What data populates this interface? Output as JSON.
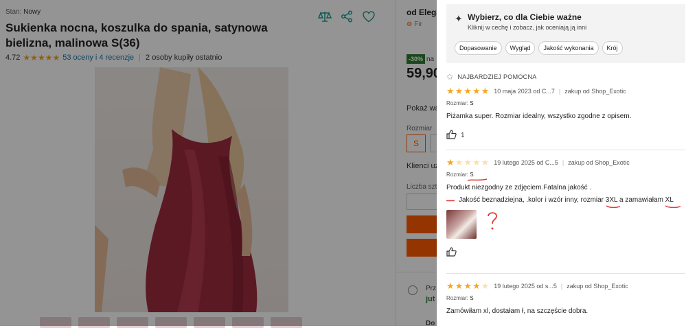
{
  "product": {
    "stan_label": "Stan:",
    "stan_value": "Nowy",
    "title": "Sukienka nocna, koszulka do spania, satynowa bielizna, malinowa S(36)",
    "rating": "4.72",
    "ratings_link": "53 oceny i 4 recenzje",
    "bought": "2 osoby kupiły ostatnio",
    "image_icon": "product-photo"
  },
  "buy_box": {
    "seller": "od Elega",
    "seller_sub": "Fir",
    "discount": "-30%",
    "discount_na": "na",
    "price": "59,90",
    "pokaz": "Pokaż wa",
    "rozmiar_label": "Rozmiar",
    "size_selected": "S",
    "klienci": "Klienci uz",
    "liczba": "Liczba szt",
    "delivery_label": "Prz",
    "delivery_value": "jut",
    "dostawa_label": "Do"
  },
  "panel": {
    "filter_title": "Wybierz, co dla Ciebie ważne",
    "filter_sub": "Kliknij w cechę i zobacz, jak oceniają ją inni",
    "chips": [
      "Dopasowanie",
      "Wygląd",
      "Jakość wykonania",
      "Krój"
    ],
    "helpful_label": "NAJBARDZIEJ POMOCNA",
    "reviews": [
      {
        "stars": 5,
        "date": "10 maja 2023 od C...7",
        "shop": "zakup od Shop_Exotic",
        "size_label": "Rozmiar:",
        "size": "S",
        "text": "Piżamka super. Rozmiar idealny, wszystko zgodne z opisem.",
        "likes": "1"
      },
      {
        "stars": 1,
        "date": "19 lutego 2025 od C...5",
        "shop": "zakup od Shop_Exotic",
        "size_label": "Rozmiar:",
        "size": "S",
        "text": "Produkt niezgodny ze zdjęciem.Fatalna jakość .",
        "text2": "Jakość beznadziejna, .kolor i wzór inny, rozmiar 3XL a zamawiałam XL",
        "likes": ""
      },
      {
        "stars": 4,
        "date": "19 lutego 2025 od s...5",
        "shop": "zakup od Shop_Exotic",
        "size_label": "Rozmiar:",
        "size": "S",
        "text": "Zamówiłam xl, dostałam ł, na szczęście dobra."
      }
    ]
  },
  "colors": {
    "accent": "#ff5a00",
    "star": "#f5a623",
    "teal_icons": "#1f9c8f",
    "annotation_red": "#e53935"
  }
}
